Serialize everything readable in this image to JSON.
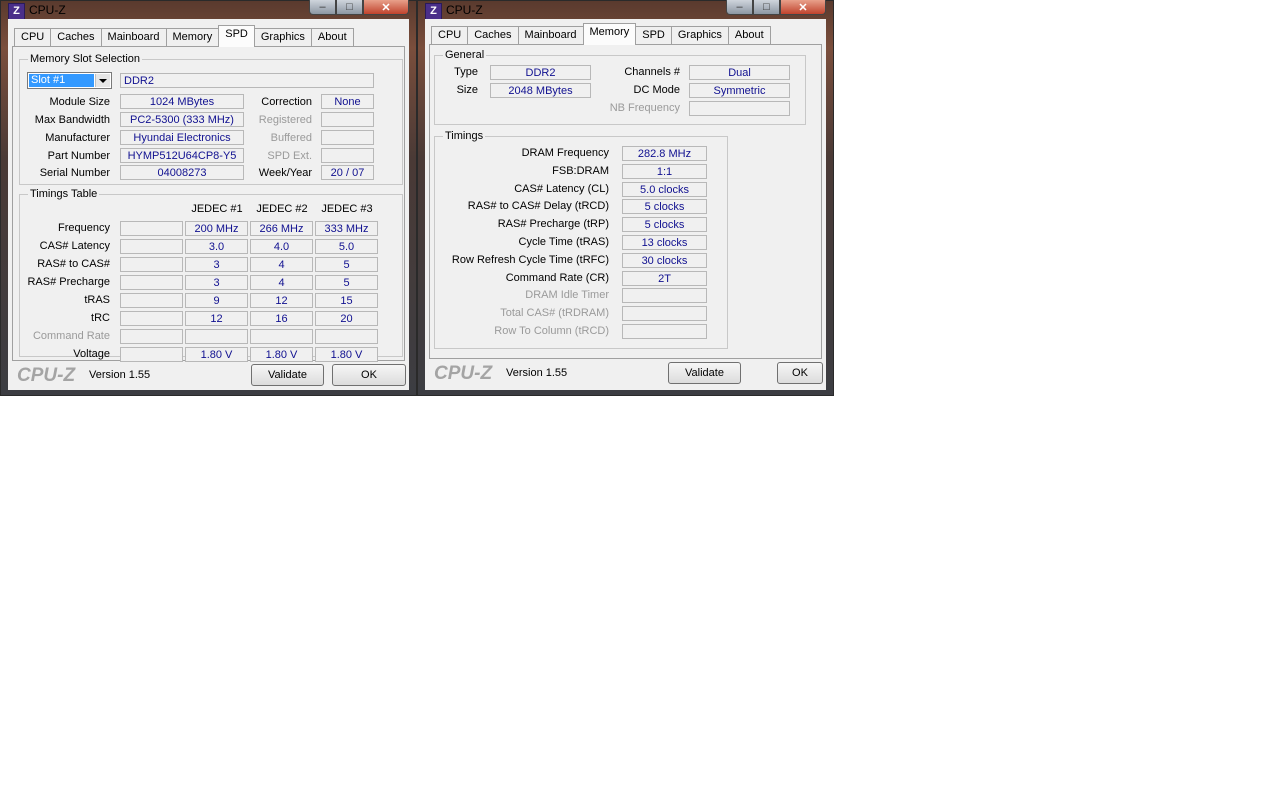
{
  "windows": [
    {
      "title": "CPU-Z",
      "icon_letter": "Z",
      "tabs": [
        "CPU",
        "Caches",
        "Mainboard",
        "Memory",
        "SPD",
        "Graphics",
        "About"
      ],
      "active_tab": "SPD",
      "slot_group_label": "Memory Slot Selection",
      "slot_select": "Slot #1",
      "memory_type": "DDR2",
      "fields": {
        "module_size": {
          "label": "Module Size",
          "value": "1024 MBytes"
        },
        "max_bandwidth": {
          "label": "Max Bandwidth",
          "value": "PC2-5300 (333 MHz)"
        },
        "manufacturer": {
          "label": "Manufacturer",
          "value": "Hyundai Electronics"
        },
        "part_number": {
          "label": "Part Number",
          "value": "HYMP512U64CP8-Y5"
        },
        "serial_number": {
          "label": "Serial Number",
          "value": "04008273"
        },
        "correction": {
          "label": "Correction",
          "value": "None"
        },
        "registered": {
          "label": "Registered",
          "value": ""
        },
        "buffered": {
          "label": "Buffered",
          "value": ""
        },
        "spd_ext": {
          "label": "SPD Ext.",
          "value": ""
        },
        "week_year": {
          "label": "Week/Year",
          "value": "20 / 07"
        }
      },
      "timings_label": "Timings Table",
      "timings_headers": [
        "JEDEC #1",
        "JEDEC #2",
        "JEDEC #3"
      ],
      "timings_rows": [
        {
          "label": "Frequency",
          "values": [
            "",
            "200 MHz",
            "266 MHz",
            "333 MHz"
          ]
        },
        {
          "label": "CAS# Latency",
          "values": [
            "",
            "3.0",
            "4.0",
            "5.0"
          ]
        },
        {
          "label": "RAS# to CAS#",
          "values": [
            "",
            "3",
            "4",
            "5"
          ]
        },
        {
          "label": "RAS# Precharge",
          "values": [
            "",
            "3",
            "4",
            "5"
          ]
        },
        {
          "label": "tRAS",
          "values": [
            "",
            "9",
            "12",
            "15"
          ]
        },
        {
          "label": "tRC",
          "values": [
            "",
            "12",
            "16",
            "20"
          ]
        },
        {
          "label": "Command Rate",
          "values": [
            "",
            "",
            "",
            ""
          ]
        },
        {
          "label": "Voltage",
          "values": [
            "",
            "1.80 V",
            "1.80 V",
            "1.80 V"
          ]
        }
      ],
      "footer": {
        "brand": "CPU-Z",
        "version": "Version 1.55",
        "validate": "Validate",
        "ok": "OK"
      }
    },
    {
      "title": "CPU-Z",
      "icon_letter": "Z",
      "tabs": [
        "CPU",
        "Caches",
        "Mainboard",
        "Memory",
        "SPD",
        "Graphics",
        "About"
      ],
      "active_tab": "Memory",
      "general_label": "General",
      "general": {
        "type": {
          "label": "Type",
          "value": "DDR2"
        },
        "size": {
          "label": "Size",
          "value": "2048 MBytes"
        },
        "channels": {
          "label": "Channels #",
          "value": "Dual"
        },
        "dc_mode": {
          "label": "DC Mode",
          "value": "Symmetric"
        },
        "nb_frequency": {
          "label": "NB Frequency",
          "value": ""
        }
      },
      "timings_label": "Timings",
      "timings": [
        {
          "label": "DRAM Frequency",
          "value": "282.8 MHz"
        },
        {
          "label": "FSB:DRAM",
          "value": "1:1"
        },
        {
          "label": "CAS# Latency (CL)",
          "value": "5.0 clocks"
        },
        {
          "label": "RAS# to CAS# Delay (tRCD)",
          "value": "5 clocks"
        },
        {
          "label": "RAS# Precharge (tRP)",
          "value": "5 clocks"
        },
        {
          "label": "Cycle Time (tRAS)",
          "value": "13 clocks"
        },
        {
          "label": "Row Refresh Cycle Time (tRFC)",
          "value": "30 clocks"
        },
        {
          "label": "Command Rate (CR)",
          "value": "2T"
        },
        {
          "label": "DRAM Idle Timer",
          "value": ""
        },
        {
          "label": "Total CAS# (tRDRAM)",
          "value": ""
        },
        {
          "label": "Row To Column (tRCD)",
          "value": ""
        }
      ],
      "footer": {
        "brand": "CPU-Z",
        "version": "Version 1.55",
        "validate": "Validate",
        "ok": "OK"
      }
    }
  ]
}
